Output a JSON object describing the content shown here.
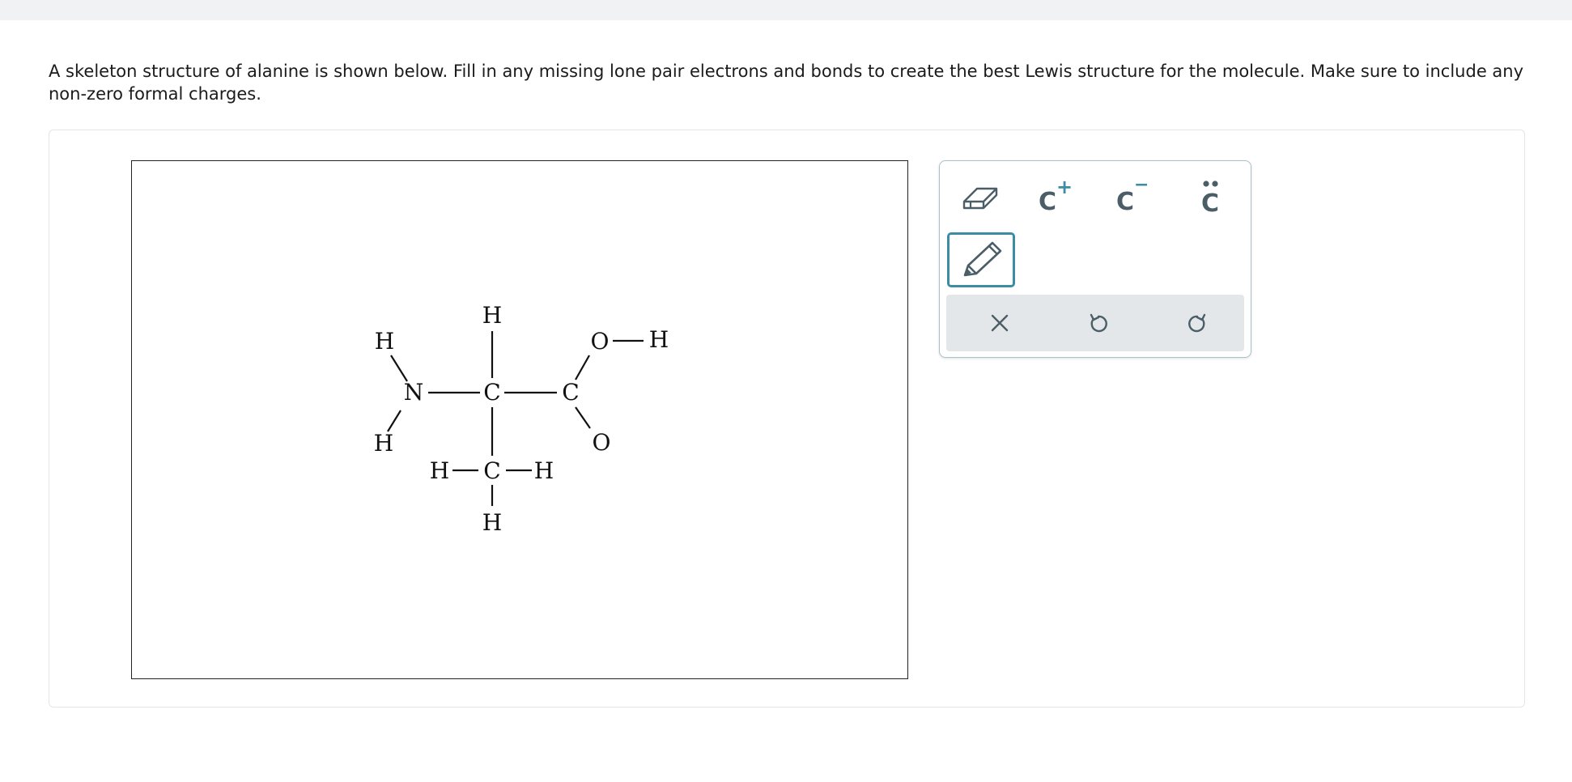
{
  "question": {
    "text": "A skeleton structure of alanine is shown below. Fill in any missing lone pair electrons and bonds to create the best Lewis structure for the molecule. Make sure to include any non-zero formal charges."
  },
  "molecule": {
    "atoms": {
      "h_nh_top": "H",
      "h_nh_bottom": "H",
      "n": "N",
      "c_alpha": "C",
      "h_alpha": "H",
      "c_carboxyl": "C",
      "o_hydroxyl": "O",
      "h_hydroxyl": "H",
      "o_carbonyl": "O",
      "c_methyl": "C",
      "h_methyl_left": "H",
      "h_methyl_right": "H",
      "h_methyl_bottom": "H"
    }
  },
  "toolbox": {
    "eraser_icon": "eraser-icon",
    "pencil_icon": "pencil-icon",
    "cation": {
      "symbol": "C",
      "charge": "+"
    },
    "anion": {
      "symbol": "C",
      "charge": "−"
    },
    "lone_pair": {
      "symbol": "C"
    },
    "clear_icon": "close-icon",
    "undo_icon": "undo-icon",
    "redo_icon": "redo-icon",
    "colors": {
      "accent": "#3c8ca3",
      "icon": "#4b5d66",
      "bar": "#e3e7ea",
      "border": "#a9c1cc"
    }
  }
}
